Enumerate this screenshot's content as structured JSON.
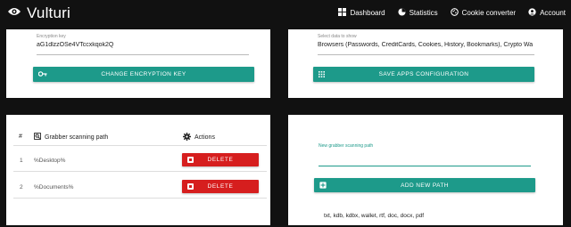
{
  "brand": {
    "name": "Vulturi"
  },
  "nav": [
    {
      "label": "Dashboard",
      "icon": "dashboard-icon"
    },
    {
      "label": "Statistics",
      "icon": "pie-chart-icon"
    },
    {
      "label": "Cookie converter",
      "icon": "cookie-icon"
    },
    {
      "label": "Account",
      "icon": "account-icon"
    }
  ],
  "encryption": {
    "label": "Encryption key",
    "value": "aG1dlzzOSe4VTccxkqok2Q",
    "button": "CHANGE ENCRYPTION KEY"
  },
  "apps": {
    "label": "Select data to show",
    "value": "Browsers (Passwords, CreditCards, Cookies, History, Bookmarks), Crypto Wa",
    "button": "SAVE APPS CONFIGURATION"
  },
  "grabber_table": {
    "col_num": "#",
    "col_path": "Grabber scanning path",
    "col_actions": "Actions",
    "rows": [
      {
        "num": "1",
        "path": "%Desktop%",
        "action": "DELETE"
      },
      {
        "num": "2",
        "path": "%Documents%",
        "action": "DELETE"
      }
    ]
  },
  "new_path": {
    "label": "New grabber scanning path",
    "value": "",
    "button": "ADD NEW PATH",
    "extensions": "txt, kdb, kdbx, wallet, rtf, doc, docx, pdf"
  },
  "colors": {
    "accent": "#1d9a8a",
    "danger": "#d61e1e",
    "topbar": "#111111"
  }
}
